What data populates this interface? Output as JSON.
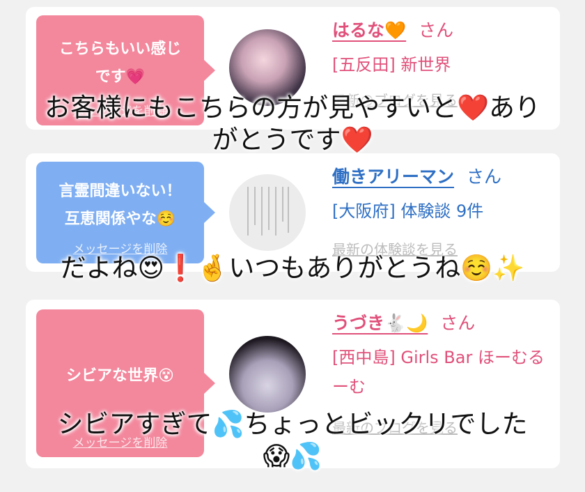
{
  "cards": [
    {
      "bubble_lines": [
        "こちらもいい感じ",
        "です💗"
      ],
      "delete_label": "メッセージを削除",
      "name": "はるな🧡",
      "san": "さん",
      "sub": "[五反田] 新世界",
      "more_link": "最新のブログを見る",
      "colors": {
        "bubble": "#f3879c",
        "text": "#e0507a"
      }
    },
    {
      "bubble_lines": [
        "言霊間違いない！",
        "互恵関係やな☺️"
      ],
      "delete_label": "メッセージを削除",
      "name": "働きアリーマン",
      "san": "さん",
      "sub": "[大阪府] 体験談 9件",
      "more_link": "最新の体験談を見る",
      "colors": {
        "bubble": "#7faff2",
        "text": "#2e6fc4"
      }
    },
    {
      "bubble_lines": [
        "シビアな世界😵"
      ],
      "delete_label": "メッセージを削除",
      "name": "うづき🐇🌙",
      "san": "さん",
      "sub": "[西中島] Girls Bar ほーむるーむ",
      "more_link": "最新のブログを見る",
      "colors": {
        "bubble": "#f3879c",
        "text": "#e0507a"
      }
    }
  ],
  "captions": [
    [
      "お客様にもこちらの方が見やすいと❤️あり",
      "がとうです❤️"
    ],
    [
      "だよね😍❗️🤞いつもありがとうね☺️✨"
    ],
    [
      "シビアすぎて💦ちょっとビックリでした",
      "😱💦"
    ]
  ]
}
